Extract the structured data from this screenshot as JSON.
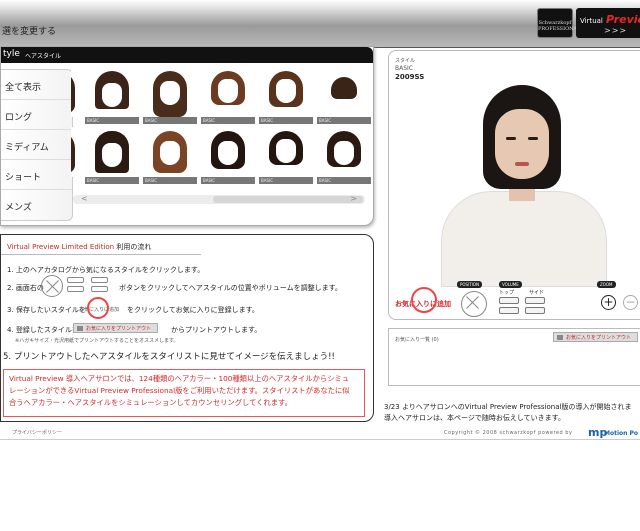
{
  "header": {
    "crumb": "選を変更する",
    "brand_logo": "Schwarzkopf PROFESSIONAL",
    "vp_virtual": "Virtual",
    "vp_preview": "Preview",
    "vp_arrows": ">>>"
  },
  "hairstyle_panel": {
    "tab_title": "tyle",
    "tab_subtitle": "ヘアスタイル",
    "categories": [
      "全て表示",
      "ロング",
      "ミディアム",
      "ショート",
      "メンズ"
    ],
    "thumb_label": "BASIC",
    "scroll_left": "<",
    "scroll_right": ">"
  },
  "instructions": {
    "title_red": "Virtual Preview Limited Edition",
    "title_black": " 利用の流れ",
    "step1": "1. 上のヘアカタログから気になるスタイルをクリックします。",
    "step2a": "2. 画面右の",
    "step2b": "ボタンをクリックしてヘアスタイルの位置やボリュームを調整します。",
    "step3a": "3. 保存したいスタイルを",
    "step3_fav": "お気に入りに追加",
    "step3b": "をクリックしてお気に入りに登録します。",
    "step4a": "4. 登録したスタイルを",
    "step4_print": "お気に入りをプリントアウト",
    "step4b": "からプリントアウトします。",
    "step4_note": "※ハガキサイズ・光沢用紙でプリントアウトすることをオススメします。",
    "step5": "5. プリントアウトしたヘアスタイルをスタイリストに見せてイメージを伝えましょう!!",
    "notice_line1": "Virtual Preview 導入ヘアサロンでは、124種類のヘアカラー・100種類以上のヘアスタイルからシミュ",
    "notice_line2": "レーションができるVirtual Preview Professional版をご利用いただけます。スタイリストがあなたに似",
    "notice_line3": "合うヘアカラー・ヘアスタイルをシミュレーションしてカウンセリングしてくれます。"
  },
  "preview": {
    "style_label": "スタイル",
    "style_basic": "BASIC",
    "style_season": "2009SS",
    "fav_add": "お気に入りに追加",
    "position_label": "POSITION",
    "volume_label": "VOLUME",
    "zoom_label": "ZOOM",
    "top_label": "トップ",
    "side_label": "サイド",
    "zoom_in": "+",
    "zoom_out": "−"
  },
  "favorites": {
    "title": "お気に入り一覧 (0)",
    "print_label": "お気に入りをプリントアウト"
  },
  "news": {
    "line1": "3/23 よりヘアサロンへのVirtual Preview Professional版の導入が開始されま",
    "line2": "導入ヘアサロンは、本ページで随時お伝えしていきます。"
  },
  "footer": {
    "privacy": "プライバシーポリシー",
    "copyright": "Copyright © 2008 schwarzkopf  powered by",
    "mp_mark": "mp",
    "mp_name": "Motion Po"
  },
  "colors": {
    "accent_red": "#d6282d",
    "header_black": "#111111",
    "link_blue": "#1e5fa6"
  }
}
